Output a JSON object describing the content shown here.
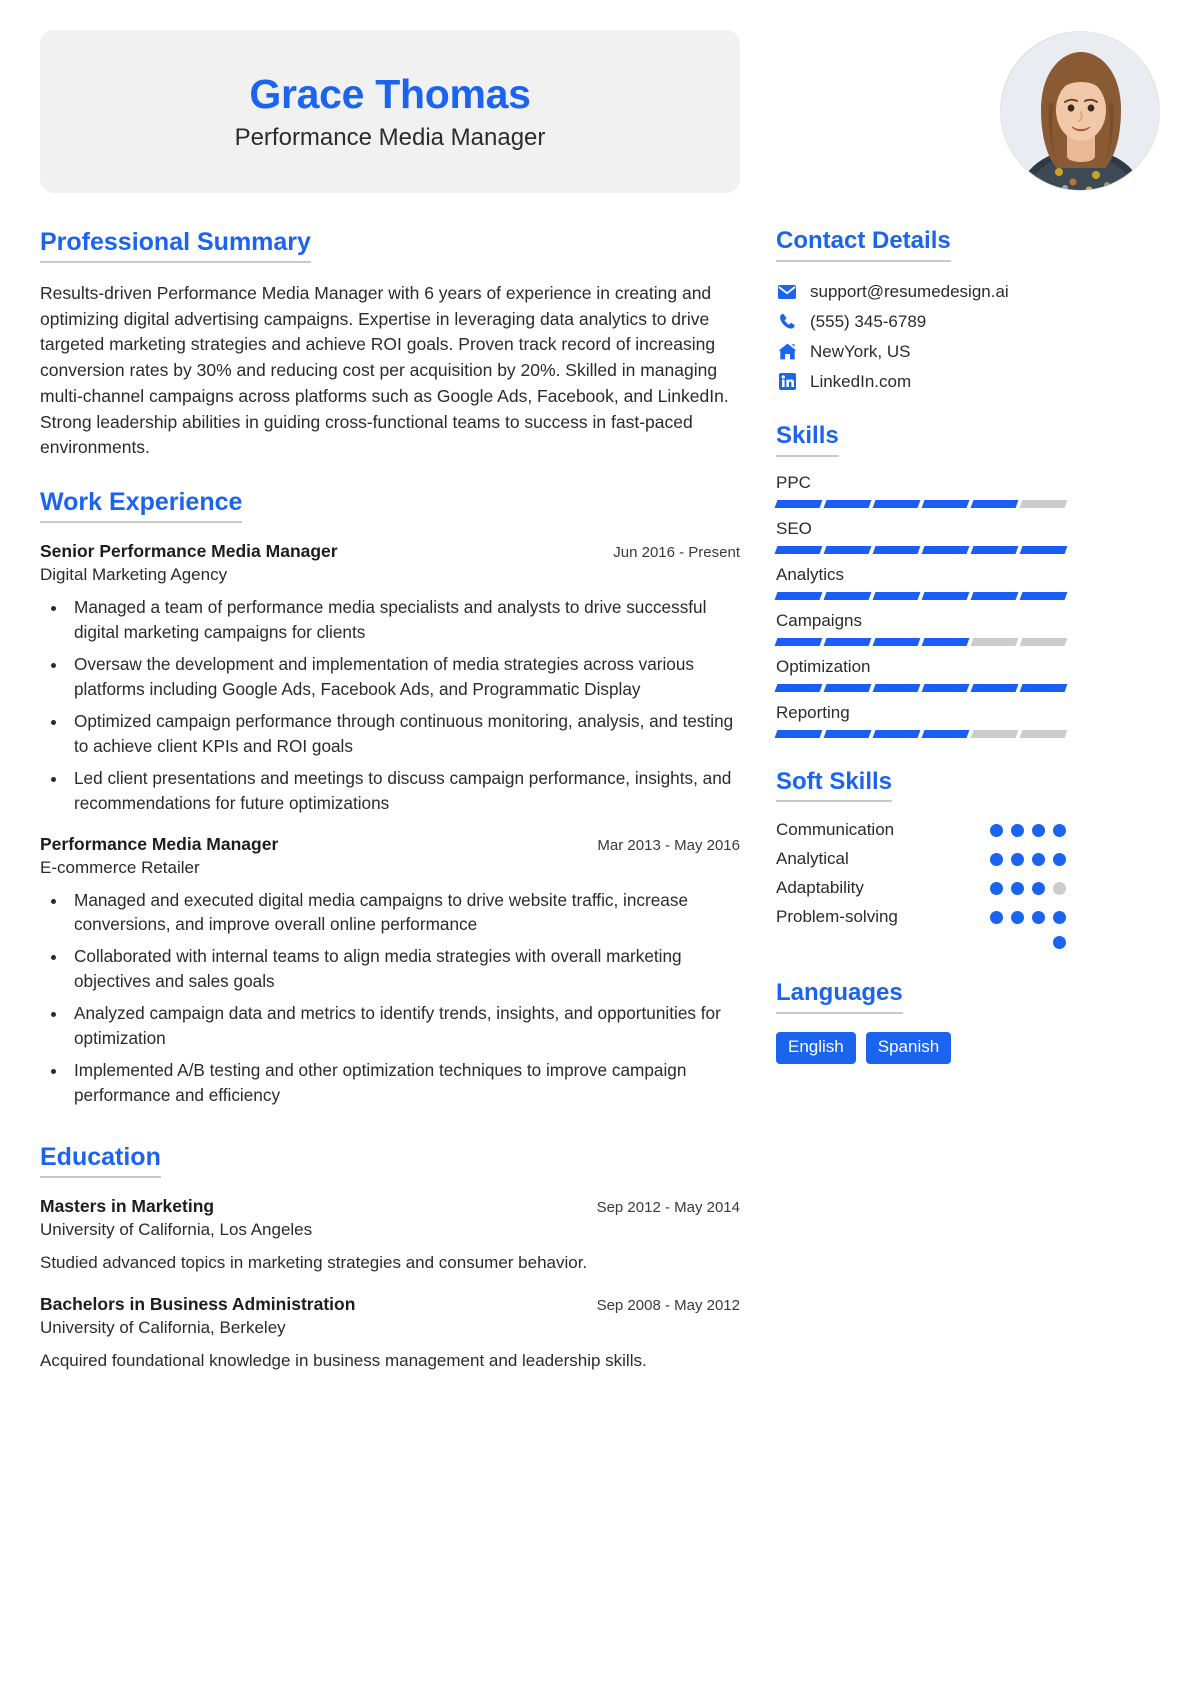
{
  "header": {
    "name": "Grace Thomas",
    "job_title": "Performance Media Manager",
    "avatar_alt": "profile-photo",
    "accent_color": "#1a64f0",
    "band_color": "#f1f1f1"
  },
  "summary": {
    "heading": "Professional Summary",
    "text": "Results-driven Performance Media Manager with 6 years of experience in creating and optimizing digital advertising campaigns. Expertise in leveraging data analytics to drive targeted marketing strategies and achieve ROI goals. Proven track record of increasing conversion rates by 30% and reducing cost per acquisition by 20%. Skilled in managing multi-channel campaigns across platforms such as Google Ads, Facebook, and LinkedIn. Strong leadership abilities in guiding cross-functional teams to success in fast-paced environments."
  },
  "work": {
    "heading": "Work Experience",
    "jobs": [
      {
        "role": "Senior Performance Media Manager",
        "dates": "Jun 2016 - Present",
        "organization": "Digital Marketing Agency",
        "bullets": [
          "Managed a team of performance media specialists and analysts to drive successful digital marketing campaigns for clients",
          "Oversaw the development and implementation of media strategies across various platforms including Google Ads, Facebook Ads, and Programmatic Display",
          "Optimized campaign performance through continuous monitoring, analysis, and testing to achieve client KPIs and ROI goals",
          "Led client presentations and meetings to discuss campaign performance, insights, and recommendations for future optimizations"
        ]
      },
      {
        "role": "Performance Media Manager",
        "dates": "Mar 2013 - May 2016",
        "organization": "E-commerce Retailer",
        "bullets": [
          "Managed and executed digital media campaigns to drive website traffic, increase conversions, and improve overall online performance",
          "Collaborated with internal teams to align media strategies with overall marketing objectives and sales goals",
          "Analyzed campaign data and metrics to identify trends, insights, and opportunities for optimization",
          "Implemented A/B testing and other optimization techniques to improve campaign performance and efficiency"
        ]
      }
    ]
  },
  "education": {
    "heading": "Education",
    "entries": [
      {
        "degree": "Masters in Marketing",
        "dates": "Sep 2012 - May 2014",
        "school": "University of California, Los Angeles",
        "description": "Studied advanced topics in marketing strategies and consumer behavior."
      },
      {
        "degree": "Bachelors in Business Administration",
        "dates": "Sep 2008 - May 2012",
        "school": "University of California, Berkeley",
        "description": "Acquired foundational knowledge in business management and leadership skills."
      }
    ]
  },
  "contact": {
    "heading": "Contact Details",
    "items": [
      {
        "icon": "envelope-icon",
        "text": "support@resumedesign.ai"
      },
      {
        "icon": "phone-icon",
        "text": "(555) 345-6789"
      },
      {
        "icon": "home-icon",
        "text": "NewYork, US"
      },
      {
        "icon": "linkedin-icon",
        "text": "LinkedIn.com"
      }
    ]
  },
  "skills": {
    "heading": "Skills",
    "segments_total": 6,
    "items": [
      {
        "name": "PPC",
        "filled": 5
      },
      {
        "name": "SEO",
        "filled": 6
      },
      {
        "name": "Analytics",
        "filled": 6
      },
      {
        "name": "Campaigns",
        "filled": 4
      },
      {
        "name": "Optimization",
        "filled": 6
      },
      {
        "name": "Reporting",
        "filled": 4
      }
    ]
  },
  "soft_skills": {
    "heading": "Soft Skills",
    "dots_total": 4,
    "items": [
      {
        "name": "Communication",
        "filled": 4
      },
      {
        "name": "Analytical",
        "filled": 4
      },
      {
        "name": "Adaptability",
        "filled": 3
      },
      {
        "name": "Problem-solving",
        "filled": 4
      },
      {
        "name": "",
        "filled": 1
      }
    ]
  },
  "languages": {
    "heading": "Languages",
    "items": [
      "English",
      "Spanish"
    ]
  }
}
